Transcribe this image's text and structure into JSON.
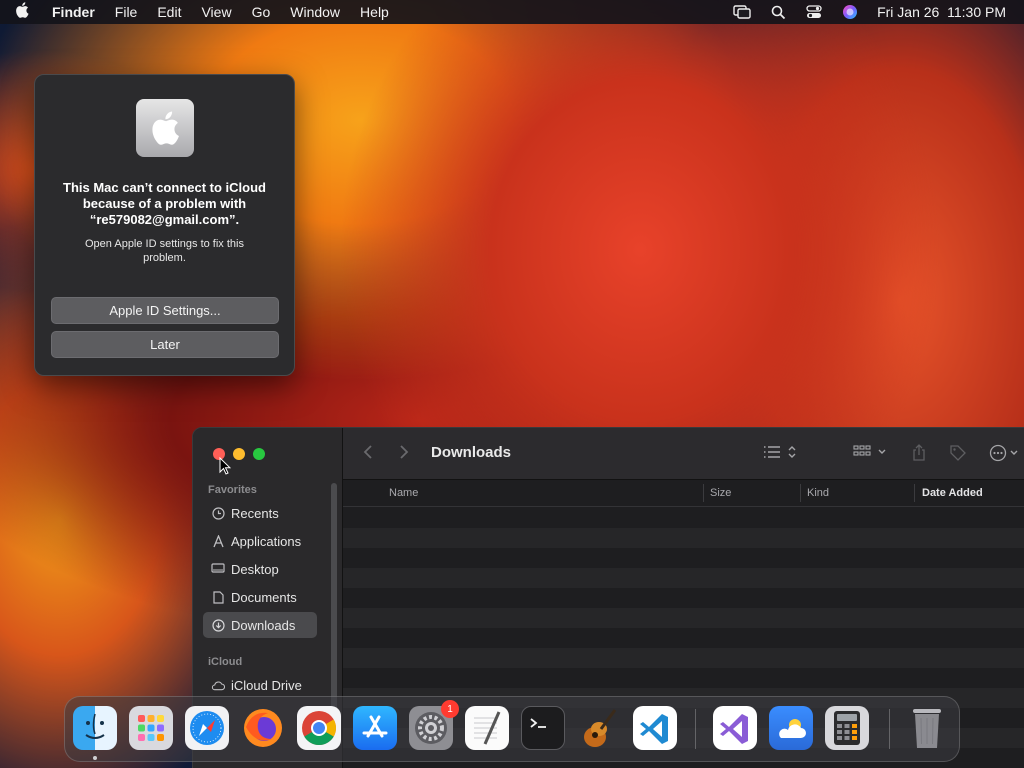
{
  "menubar": {
    "app": "Finder",
    "items": [
      "File",
      "Edit",
      "View",
      "Go",
      "Window",
      "Help"
    ],
    "datetime": "Fri Jan 26  11:30 PM"
  },
  "alert": {
    "title": "This Mac can’t connect to iCloud because of a problem with “re579082@gmail.com”.",
    "message": "Open Apple ID settings to fix this problem.",
    "primary_button": "Apple ID Settings...",
    "secondary_button": "Later"
  },
  "finder": {
    "title": "Downloads",
    "sidebar": {
      "favorites_header": "Favorites",
      "favorites": [
        {
          "label": "Recents",
          "icon": "clock-icon"
        },
        {
          "label": "Applications",
          "icon": "applications-icon"
        },
        {
          "label": "Desktop",
          "icon": "desktop-icon"
        },
        {
          "label": "Documents",
          "icon": "document-icon"
        },
        {
          "label": "Downloads",
          "icon": "download-icon"
        }
      ],
      "icloud_header": "iCloud",
      "icloud": [
        {
          "label": "iCloud Drive",
          "icon": "cloud-icon"
        }
      ]
    },
    "columns": [
      "Name",
      "Size",
      "Kind",
      "Date Added"
    ]
  },
  "dock": {
    "apps": [
      {
        "name": "Finder",
        "icon": "finder-icon"
      },
      {
        "name": "Launchpad",
        "icon": "launchpad-icon"
      },
      {
        "name": "Safari",
        "icon": "safari-icon"
      },
      {
        "name": "Firefox",
        "icon": "firefox-icon"
      },
      {
        "name": "Chrome",
        "icon": "chrome-icon"
      },
      {
        "name": "App Store",
        "icon": "app-store-icon"
      },
      {
        "name": "System Settings",
        "icon": "system-settings-icon",
        "badge": "1"
      },
      {
        "name": "TextEdit",
        "icon": "textedit-icon"
      },
      {
        "name": "Terminal",
        "icon": "terminal-icon"
      },
      {
        "name": "GarageBand",
        "icon": "garageband-icon"
      },
      {
        "name": "Visual Studio Code",
        "icon": "vscode-icon"
      },
      {
        "name": "Visual Studio",
        "icon": "visual-studio-icon"
      },
      {
        "name": "Weather",
        "icon": "weather-icon"
      },
      {
        "name": "Calculator",
        "icon": "calculator-icon"
      },
      {
        "name": "Trash",
        "icon": "trash-icon"
      }
    ]
  },
  "colors": {
    "close": "#ff5f57",
    "minimize": "#febc2e",
    "zoom": "#28c840",
    "badge": "#ff3b30"
  }
}
